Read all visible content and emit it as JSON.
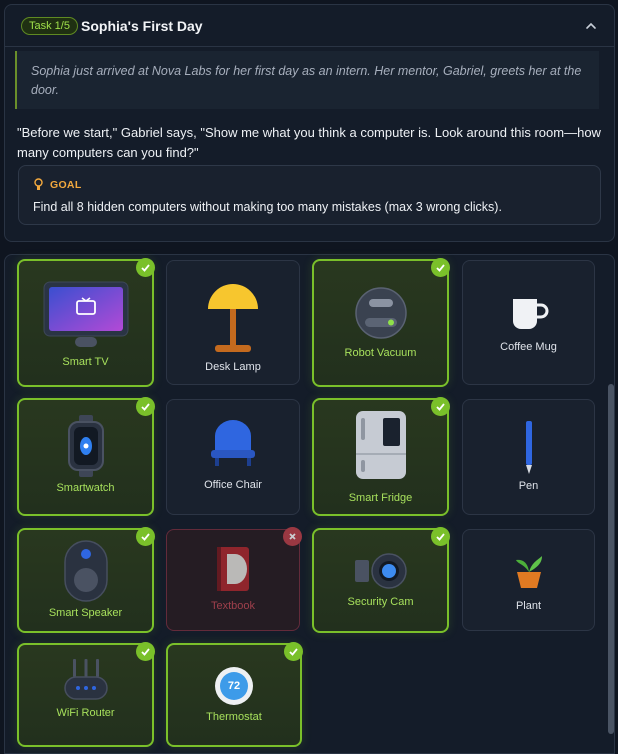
{
  "task": {
    "badge": "Task 1/5",
    "title": "Sophia's First Day",
    "narration": "Sophia just arrived at Nova Labs for her first day as an intern. Her mentor, Gabriel, greets her at the door.",
    "dialogue": "\"Before we start,\" Gabriel says, \"Show me what you think a computer is. Look around this room—how many computers can you find?\"",
    "goal_label": "GOAL",
    "goal_text": "Find all 8 hidden computers without making too many mistakes (max 3 wrong clicks)."
  },
  "items": [
    {
      "label": "Smart TV",
      "status": "found",
      "icon": "tv-icon"
    },
    {
      "label": "Desk Lamp",
      "status": "idle",
      "icon": "lamp-icon"
    },
    {
      "label": "Robot Vacuum",
      "status": "found",
      "icon": "robot-vacuum-icon"
    },
    {
      "label": "Coffee Mug",
      "status": "idle",
      "icon": "mug-icon"
    },
    {
      "label": "Smartwatch",
      "status": "found",
      "icon": "watch-icon"
    },
    {
      "label": "Office Chair",
      "status": "idle",
      "icon": "chair-icon"
    },
    {
      "label": "Smart Fridge",
      "status": "found",
      "icon": "fridge-icon"
    },
    {
      "label": "Pen",
      "status": "idle",
      "icon": "pen-icon"
    },
    {
      "label": "Smart Speaker",
      "status": "found",
      "icon": "speaker-icon"
    },
    {
      "label": "Textbook",
      "status": "wrong",
      "icon": "book-icon"
    },
    {
      "label": "Security Cam",
      "status": "found",
      "icon": "camera-icon"
    },
    {
      "label": "Plant",
      "status": "idle",
      "icon": "plant-icon"
    },
    {
      "label": "WiFi Router",
      "status": "found",
      "icon": "router-icon"
    },
    {
      "label": "Thermostat",
      "status": "found",
      "icon": "thermostat-icon",
      "reading": "72"
    }
  ],
  "colors": {
    "found": "#7ac02a",
    "wrong": "#c0404a",
    "accent": "#f3a93e"
  }
}
